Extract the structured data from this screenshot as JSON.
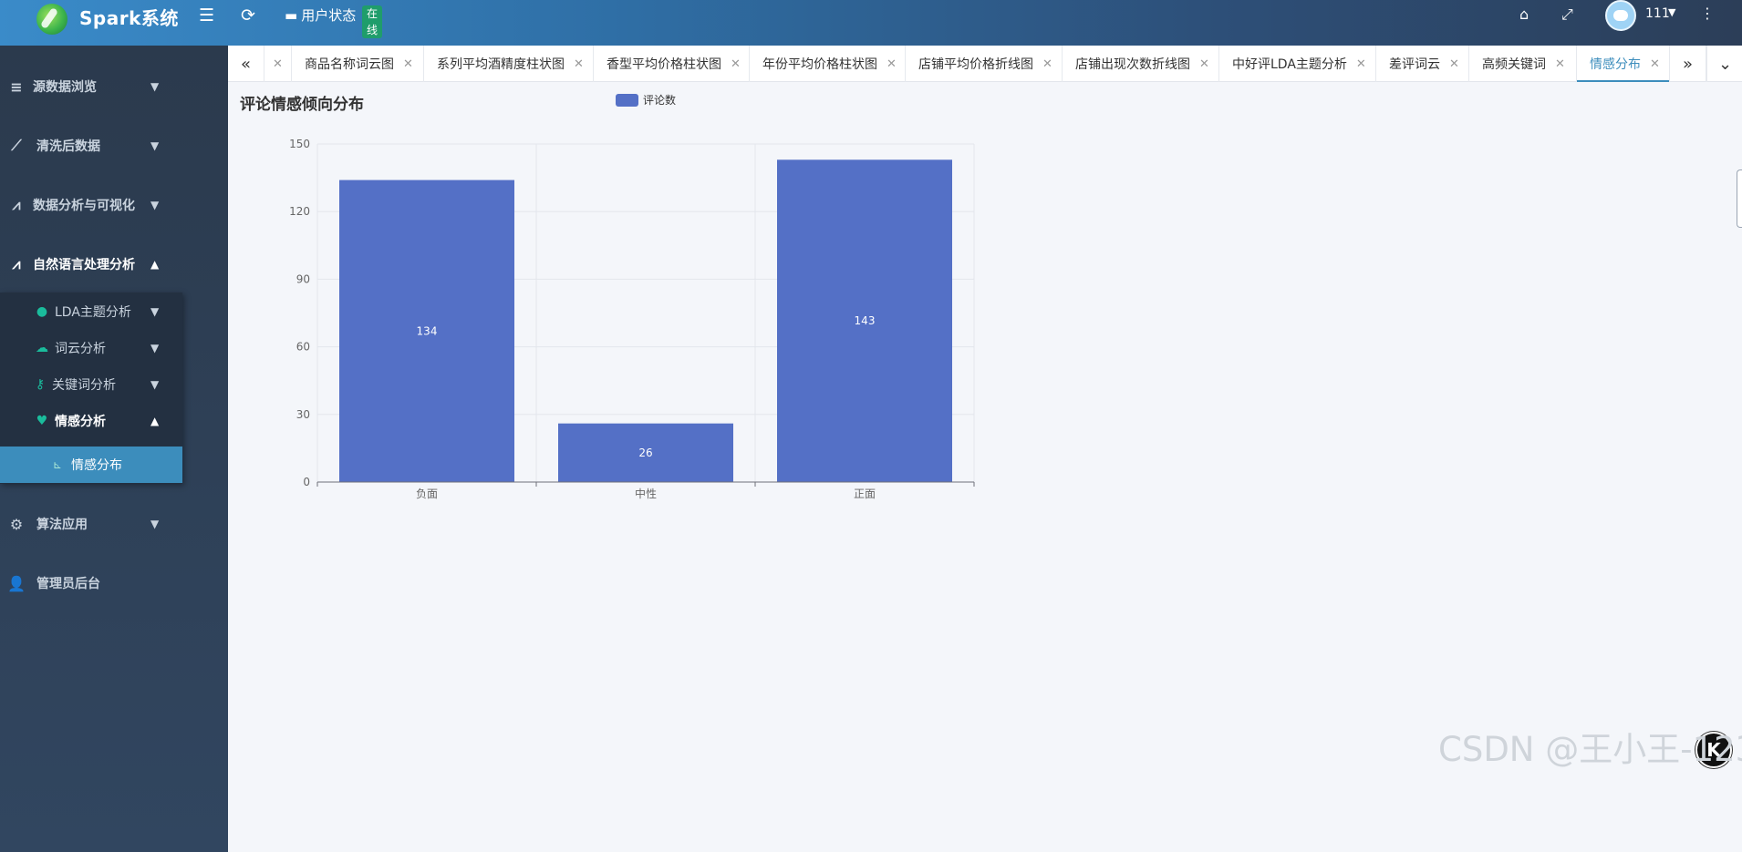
{
  "header": {
    "brand": "Spark系统",
    "user_status_label": "用户状态",
    "status_badge": "在\n线",
    "username": "111",
    "icons": [
      "menu-fold-icon",
      "refresh-icon",
      "tag-icon",
      "fullscreen-icon",
      "more-vertical-icon"
    ]
  },
  "sidebar": {
    "items": [
      {
        "label": "源数据浏览",
        "icon": "database-icon"
      },
      {
        "label": "清洗后数据",
        "icon": "broom-icon"
      },
      {
        "label": "数据分析与可视化",
        "icon": "line-chart-icon"
      },
      {
        "label": "自然语言处理分析",
        "icon": "line-chart-icon"
      },
      {
        "label": "算法应用",
        "icon": "robot-icon"
      },
      {
        "label": "管理员后台",
        "icon": "admin-icon"
      }
    ],
    "subitems": [
      {
        "label": "LDA主题分析",
        "icon": "comments-icon"
      },
      {
        "label": "词云分析",
        "icon": "cloud-icon"
      },
      {
        "label": "关键词分析",
        "icon": "key-icon"
      },
      {
        "label": "情感分析",
        "icon": "heart-pulse-icon"
      }
    ],
    "leaf": {
      "label": "情感分布",
      "icon": "chart-icon"
    }
  },
  "tabs": [
    {
      "label": "商品名称词云图"
    },
    {
      "label": "系列平均酒精度柱状图"
    },
    {
      "label": "香型平均价格柱状图"
    },
    {
      "label": "年份平均价格柱状图"
    },
    {
      "label": "店铺平均价格折线图"
    },
    {
      "label": "店铺出现次数折线图"
    },
    {
      "label": "中好评LDA主题分析"
    },
    {
      "label": "差评词云"
    },
    {
      "label": "高频关键词"
    },
    {
      "label": "情感分布",
      "active": true
    }
  ],
  "chart_data": {
    "type": "bar",
    "title": "评论情感倾向分布",
    "categories": [
      "负面",
      "中性",
      "正面"
    ],
    "series": [
      {
        "name": "评论数",
        "values": [
          134,
          26,
          143
        ],
        "color": "#5470c6"
      }
    ],
    "ylim": [
      0,
      150
    ],
    "yticks": [
      0,
      30,
      60,
      90,
      120,
      150
    ],
    "grid": true,
    "legend": "top-center"
  },
  "watermark": "CSDN @王小王-123",
  "fab_label": "K"
}
